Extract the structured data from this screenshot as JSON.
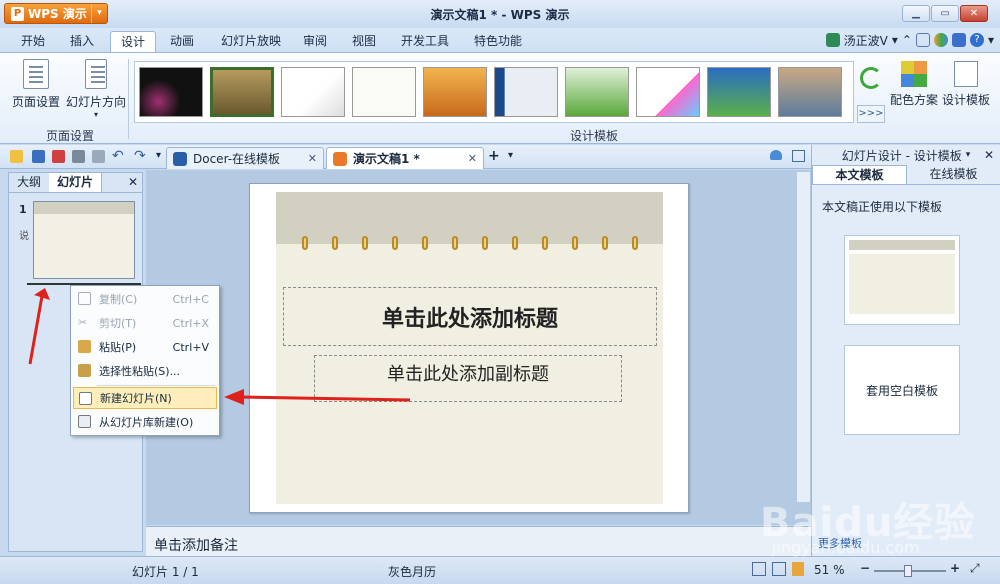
{
  "app": {
    "wps_button": "WPS 演示",
    "window_title": "演示文稿1 * - WPS 演示"
  },
  "menu_tabs": [
    "开始",
    "插入",
    "设计",
    "动画",
    "幻灯片放映",
    "审阅",
    "视图",
    "开发工具",
    "特色功能"
  ],
  "active_menu_tab": "设计",
  "user": {
    "name": "汤正波V"
  },
  "ribbon": {
    "page_setup_label": "页面设置",
    "orientation_label": "幻灯片方向",
    "page_setup_group": "页面设置",
    "design_group": "设计模板",
    "color_scheme": "配色方案",
    "design_template": "设计模板",
    "more_label": ">>>"
  },
  "doc_tabs": [
    {
      "label": "Docer-在线模板",
      "icon": "docer-icon"
    },
    {
      "label": "演示文稿1 *",
      "icon": "presentation-icon"
    }
  ],
  "left_pane": {
    "tab_outline": "大纲",
    "tab_slides": "幻灯片",
    "slide_number": "1",
    "slide_partial": "说"
  },
  "context_menu": [
    {
      "label": "复制(C)",
      "shortcut": "Ctrl+C",
      "disabled": true,
      "icon": "copy-icon"
    },
    {
      "label": "剪切(T)",
      "shortcut": "Ctrl+X",
      "disabled": true,
      "icon": "cut-icon"
    },
    {
      "label": "粘贴(P)",
      "shortcut": "Ctrl+V",
      "disabled": false,
      "icon": "paste-icon"
    },
    {
      "label": "选择性粘贴(S)...",
      "shortcut": "",
      "disabled": false,
      "icon": "paste-special-icon"
    },
    {
      "label": "新建幻灯片(N)",
      "shortcut": "",
      "disabled": false,
      "icon": "new-slide-icon",
      "highlighted": true
    },
    {
      "label": "从幻灯片库新建(O)",
      "shortcut": "",
      "disabled": false,
      "icon": "slide-library-icon"
    }
  ],
  "slide": {
    "title_placeholder": "单击此处添加标题",
    "subtitle_placeholder": "单击此处添加副标题"
  },
  "notes_placeholder": "单击添加备注",
  "right_pane": {
    "header": "幻灯片设计 - 设计模板",
    "tab_this": "本文模板",
    "tab_online": "在线模板",
    "note": "本文稿正使用以下模板",
    "blank_template": "套用空白模板",
    "more_templates": "更多模板"
  },
  "status": {
    "slide_info": "幻灯片 1 / 1",
    "theme_name": "灰色月历",
    "zoom": "51 %"
  },
  "watermark": {
    "brand": "Baidu经验",
    "url": "jingyan.baidu.com"
  },
  "colors": {
    "accent_orange": "#e06a10",
    "highlight": "#fdeebc",
    "arrow_red": "#e0201a"
  }
}
